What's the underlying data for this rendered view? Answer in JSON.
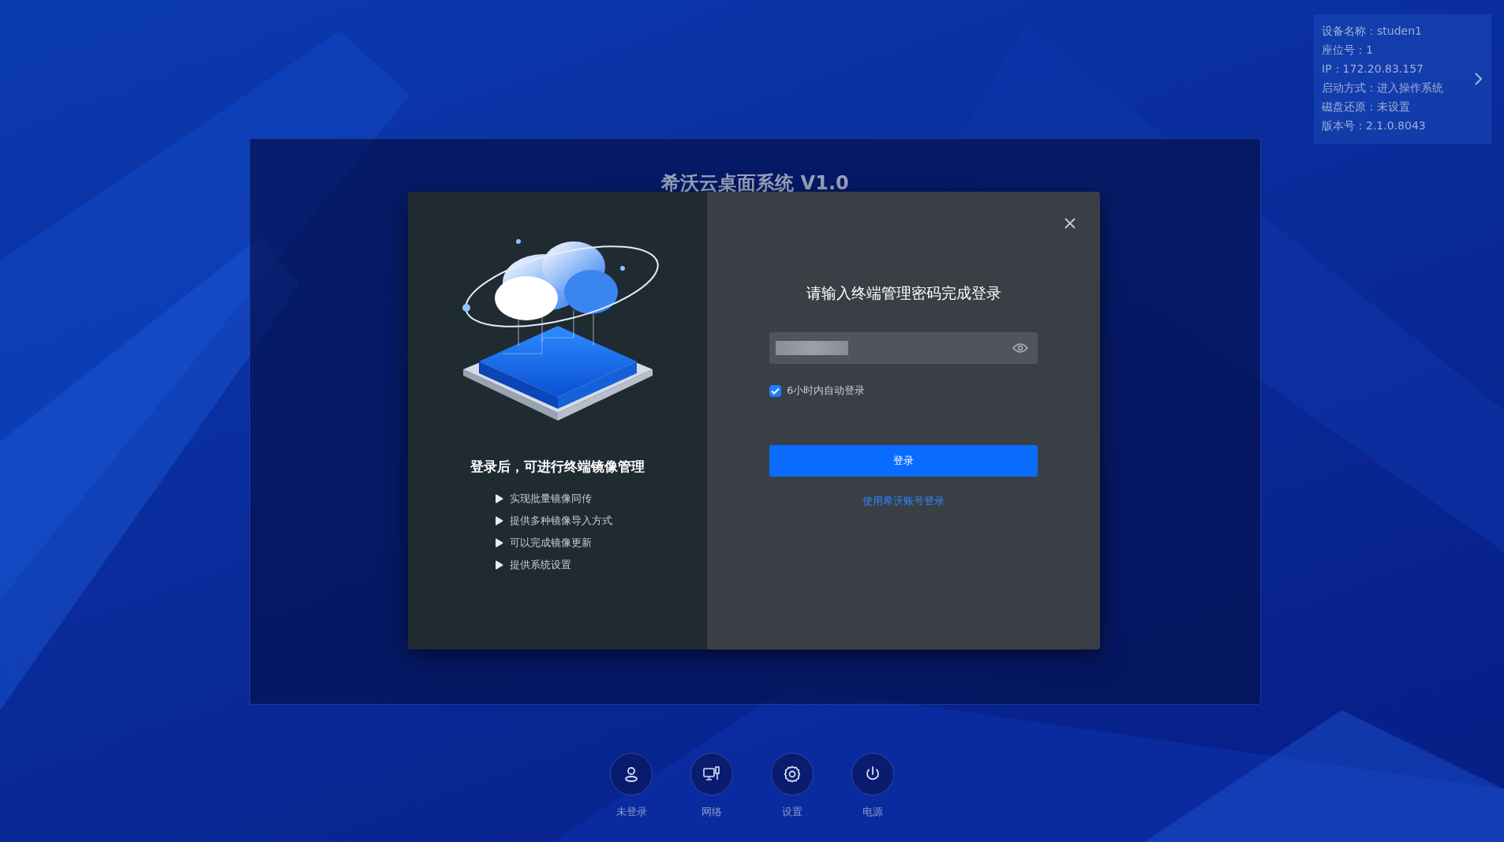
{
  "background_title": "希沃云桌面系统 V1.0",
  "device_info": {
    "lines": [
      "设备名称：studen1",
      "座位号：1",
      "IP：172.20.83.157",
      "启动方式：进入操作系统",
      "磁盘还原：未设置",
      "版本号：2.1.0.8043"
    ]
  },
  "dialog": {
    "feature_heading": "登录后，可进行终端镜像管理",
    "features": [
      "实现批量镜像同传",
      "提供多种镜像导入方式",
      "可以完成镜像更新",
      "提供系统设置"
    ],
    "prompt": "请输入终端管理密码完成登录",
    "auto_login": {
      "label": "6小时内自动登录",
      "checked": true
    },
    "login_button": "登录",
    "alt_login_link": "使用希沃账号登录"
  },
  "dock": [
    {
      "label": "未登录",
      "kind": "user"
    },
    {
      "label": "网络",
      "kind": "network"
    },
    {
      "label": "设置",
      "kind": "settings"
    },
    {
      "label": "电源",
      "kind": "power"
    }
  ]
}
